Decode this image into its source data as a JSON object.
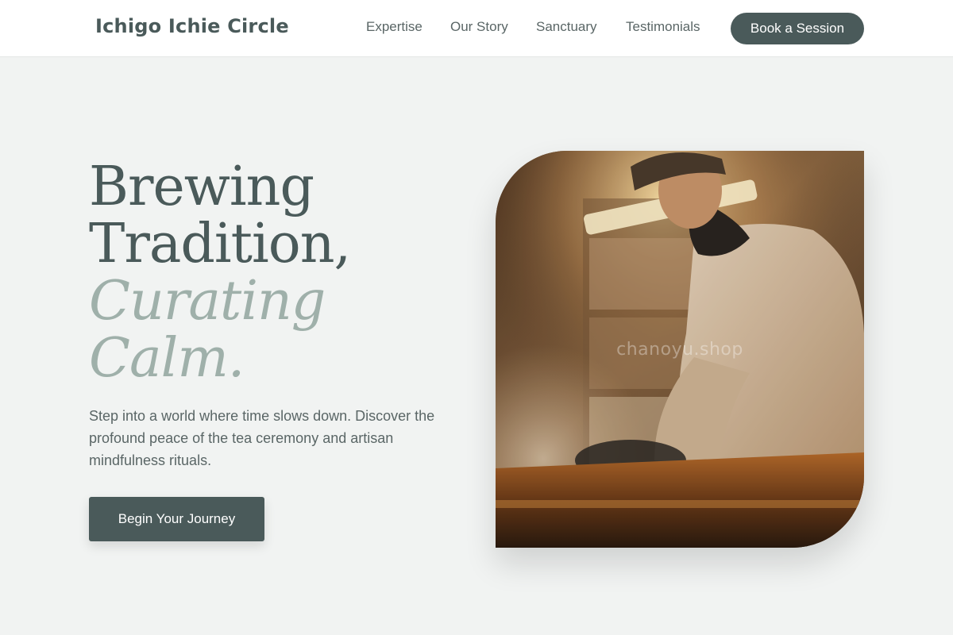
{
  "header": {
    "brand": "Ichigo Ichie Circle",
    "nav": [
      "Expertise",
      "Our Story",
      "Sanctuary",
      "Testimonials"
    ],
    "cta_label": "Book a Session"
  },
  "hero": {
    "headline_lines": [
      "Brewing",
      "Tradition,",
      "Curating",
      "Calm."
    ],
    "lede": "Step into a world where time slows down. Discover the profound peace of the tea ceremony and artisan mindfulness rituals.",
    "cta_label": "Begin Your Journey",
    "image": {
      "watermark": "chanoyu.shop"
    }
  },
  "colors": {
    "page_bg": "#f1f3f2",
    "primary": "#4a5a5a",
    "accent_italic": "#9fb0aa",
    "text": "#5a6666"
  },
  "icons": []
}
